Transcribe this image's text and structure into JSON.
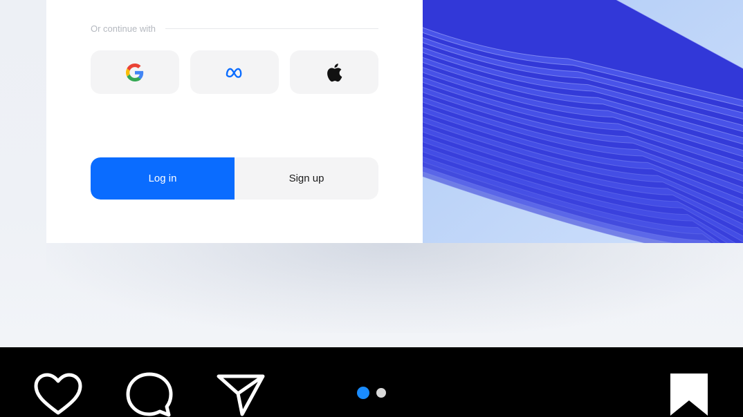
{
  "login_card": {
    "divider_text": "Or continue with",
    "social": [
      {
        "name": "google",
        "icon": "google-icon"
      },
      {
        "name": "meta",
        "icon": "meta-icon"
      },
      {
        "name": "apple",
        "icon": "apple-icon"
      }
    ],
    "login_label": "Log in",
    "signup_label": "Sign up"
  },
  "colors": {
    "primary": "#0a6cff",
    "art_blue": "#3a3fe0",
    "art_bg": "#bfd6f8",
    "dot_active": "#1a8cff",
    "dot_inactive": "#d9d9d9"
  },
  "carousel": {
    "page_count": 2,
    "active_index": 0
  },
  "action_bar": {
    "icons": [
      "heart-icon",
      "comment-icon",
      "share-icon",
      "bookmark-icon"
    ]
  }
}
